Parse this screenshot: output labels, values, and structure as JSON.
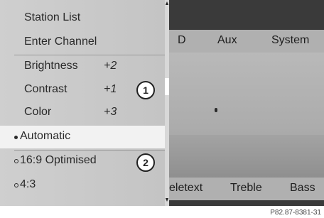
{
  "menu": {
    "items": [
      {
        "label": "Station List",
        "value": ""
      },
      {
        "label": "Enter Channel",
        "value": ""
      },
      {
        "label": "Brightness",
        "value": "+2"
      },
      {
        "label": "Contrast",
        "value": "+1"
      },
      {
        "label": "Color",
        "value": "+3"
      }
    ],
    "format_options": [
      {
        "label": "Automatic",
        "selected": true
      },
      {
        "label": "16:9 Optimised",
        "selected": false
      },
      {
        "label": "4:3",
        "selected": false
      }
    ]
  },
  "topbar": {
    "items": [
      "D",
      "Aux",
      "System"
    ]
  },
  "bottombar": {
    "items": [
      "eletext",
      "Treble",
      "Bass"
    ]
  },
  "callouts": [
    "1",
    "2"
  ],
  "figure_ref": "P82.87-8381-31",
  "colors": {
    "menu_bg": "#c8c8c8",
    "selected_bg": "#f2f2f2",
    "bar_bg": "#b0b0b0"
  }
}
